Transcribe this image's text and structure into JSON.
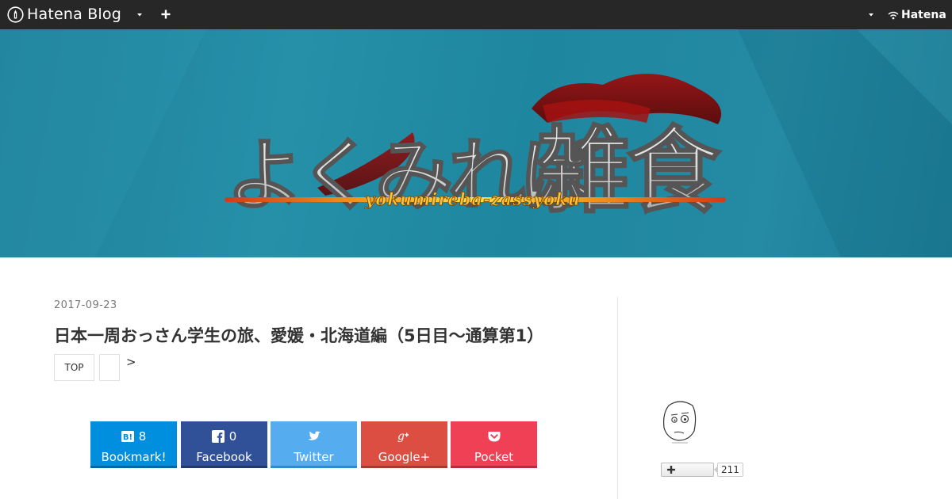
{
  "global_header": {
    "logo_text": "Hatena Blog",
    "hatena_text": "Hatena"
  },
  "banner": {
    "title_kana": "よくみれば",
    "title_kanji": "雑食",
    "subtitle": "yokumireba-zassyoku"
  },
  "entry": {
    "date": "2017-09-23",
    "title": "日本一周おっさん学生の旅、愛媛・北海道編（5日目〜通算第1）",
    "top_label": "TOP",
    "next_arrow": ">"
  },
  "share": [
    {
      "label": "Bookmark!",
      "count": "8",
      "icon": "hatena-bookmark-icon",
      "color": "#008fde"
    },
    {
      "label": "Facebook",
      "count": "0",
      "icon": "facebook-icon",
      "color": "#305097"
    },
    {
      "label": "Twitter",
      "count": "",
      "icon": "twitter-icon",
      "color": "#55acee"
    },
    {
      "label": "Google+",
      "count": "",
      "icon": "google-plus-icon",
      "color": "#dc4e41"
    },
    {
      "label": "Pocket",
      "count": "",
      "icon": "pocket-icon",
      "color": "#ef4056"
    }
  ],
  "sidebar": {
    "follow_count": "211"
  }
}
